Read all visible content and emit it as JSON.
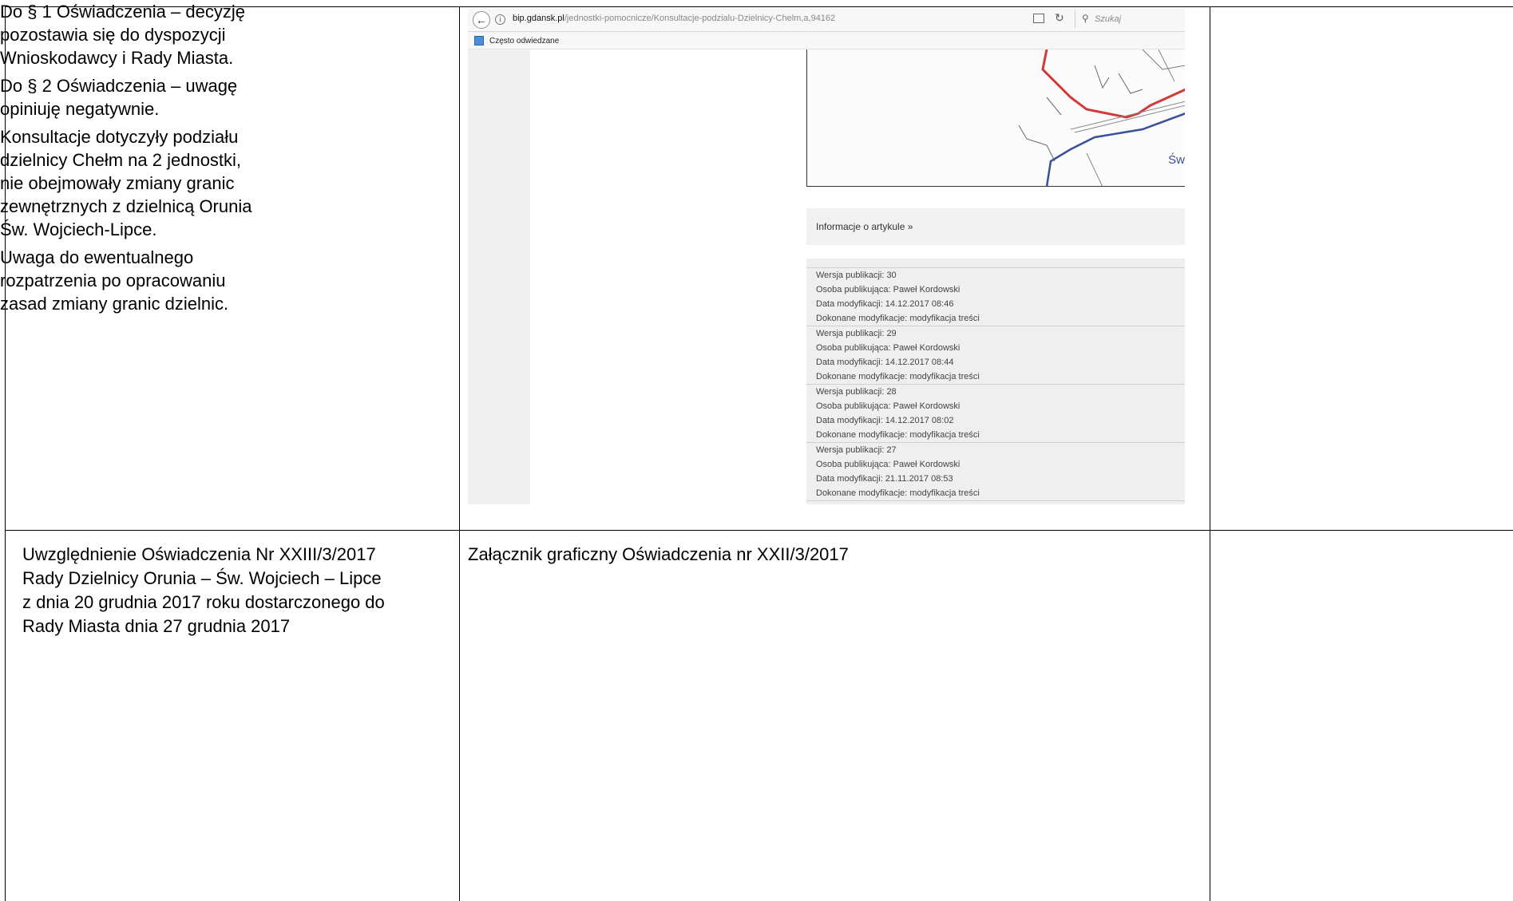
{
  "browser": {
    "url_host": "bip.gdansk.pl",
    "url_path": "/jednostki-pomocnicze/Konsultacje-podzialu-Dzielnicy-Chelm,a,94162",
    "search_placeholder": "Szukaj",
    "bookmark_label": "Często odwiedzane",
    "back_icon": "arrow-left-icon",
    "info_icon": "info-icon"
  },
  "article": {
    "map_place_label": "Św",
    "info_link": "Informacje o artykule »",
    "versions": [
      {
        "version": "Wersja publikacji: 30",
        "author": "Osoba publikująca: Paweł Kordowski",
        "date": "Data modyfikacji: 14.12.2017 08:46",
        "change": "Dokonane modyfikacje: modyfikacja treści"
      },
      {
        "version": "Wersja publikacji: 29",
        "author": "Osoba publikująca: Paweł Kordowski",
        "date": "Data modyfikacji: 14.12.2017 08:44",
        "change": "Dokonane modyfikacje: modyfikacja treści"
      },
      {
        "version": "Wersja publikacji: 28",
        "author": "Osoba publikująca: Paweł Kordowski",
        "date": "Data modyfikacji: 14.12.2017 08:02",
        "change": "Dokonane modyfikacje: modyfikacja treści"
      },
      {
        "version": "Wersja publikacji: 27",
        "author": "Osoba publikująca: Paweł Kordowski",
        "date": "Data modyfikacji: 21.11.2017 08:53",
        "change": "Dokonane modyfikacje: modyfikacja treści"
      }
    ]
  },
  "table": {
    "row2_col1": [
      "Uwzględnienie Oświadczenia Nr XXIII/3/2017",
      "Rady Dzielnicy Orunia – Św. Wojciech – Lipce",
      "z dnia 20 grudnia 2017 roku dostarczonego do",
      "Rady Miasta dnia 27 grudnia 2017"
    ],
    "row2_col2": "Załącznik graficzny Oświadczenia nr XXII/3/2017",
    "row2_col3": [
      [
        "Do § 1 Oświadczenia – decyzję",
        "pozostawia się do dyspozycji",
        "Wnioskodawcy i Rady Miasta."
      ],
      [
        "Do § 2 Oświadczenia – uwagę",
        "opiniuję negatywnie."
      ],
      [
        "Konsultacje dotyczyły podziału",
        "dzielnicy Chełm na 2 jednostki,",
        "nie obejmowały zmiany granic",
        "zewnętrznych z dzielnicą Orunia",
        "Św. Wojciech-Lipce."
      ],
      [
        "Uwaga do ewentualnego",
        "rozpatrzenia po opracowaniu",
        "zasad zmiany granic dzielnic."
      ]
    ]
  }
}
